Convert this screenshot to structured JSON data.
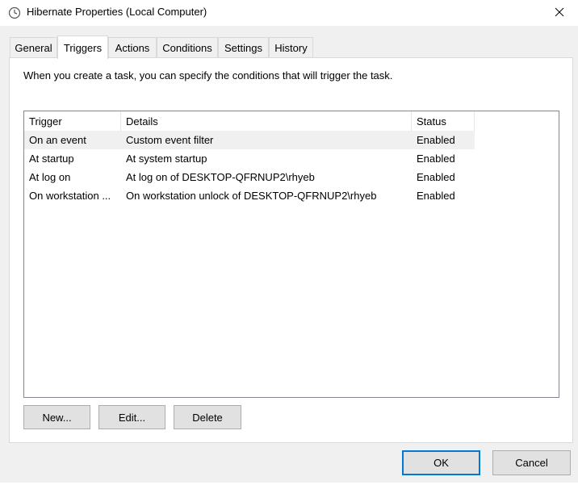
{
  "window": {
    "title": "Hibernate Properties (Local Computer)",
    "icon": "clock-icon",
    "close_glyph": "✕"
  },
  "tabs": [
    {
      "label": "General"
    },
    {
      "label": "Triggers",
      "active": true
    },
    {
      "label": "Actions"
    },
    {
      "label": "Conditions"
    },
    {
      "label": "Settings"
    },
    {
      "label": "History"
    }
  ],
  "panel": {
    "description": "When you create a task, you can specify the conditions that will trigger the task."
  },
  "triggers_table": {
    "headers": {
      "trigger": "Trigger",
      "details": "Details",
      "status": "Status"
    },
    "rows": [
      {
        "trigger": "On an event",
        "details": "Custom event filter",
        "status": "Enabled"
      },
      {
        "trigger": "At startup",
        "details": "At system startup",
        "status": "Enabled"
      },
      {
        "trigger": "At log on",
        "details": "At log on of DESKTOP-QFRNUP2\\rhyeb",
        "status": "Enabled"
      },
      {
        "trigger": "On workstation ...",
        "details": "On workstation unlock of DESKTOP-QFRNUP2\\rhyeb",
        "status": "Enabled"
      }
    ]
  },
  "actions": {
    "new_label": "New...",
    "edit_label": "Edit...",
    "delete_label": "Delete"
  },
  "dialog_buttons": {
    "ok_label": "OK",
    "cancel_label": "Cancel"
  },
  "colors": {
    "accent": "#0078d7",
    "selected_row": "#f0f0f0"
  }
}
